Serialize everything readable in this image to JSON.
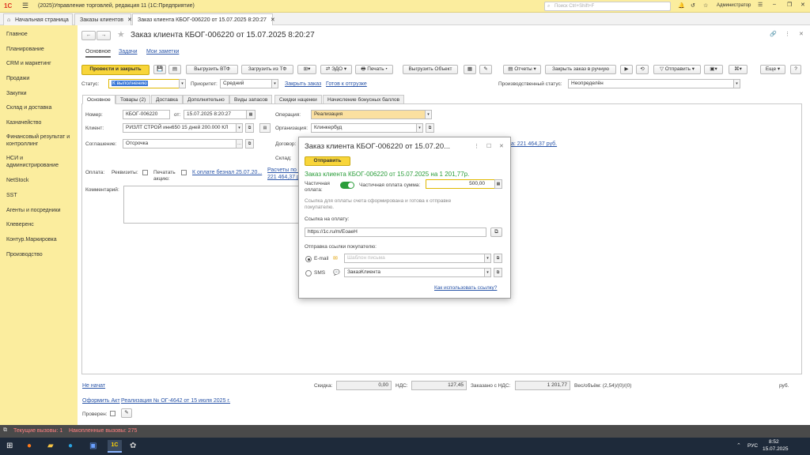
{
  "titlebar": {
    "title": "(2025)Управление торговлей, редакция 11  (1С:Предприятие)",
    "search_placeholder": "Поиск Ctrl+Shift+F",
    "user": "Администратор"
  },
  "tabs": [
    {
      "label": "Начальная страница"
    },
    {
      "label": "Заказы клиентов"
    },
    {
      "label": "Заказ клиента КБОГ-006220 от 15.07.2025 8:20:27"
    }
  ],
  "sidebar": {
    "items": [
      "Главное",
      "Планирование",
      "CRM и маркетинг",
      "Продажи",
      "Закупки",
      "Склад и доставка",
      "Казначейство",
      "Финансовый результат и контроллинг",
      "НСИ и администрирование",
      "NetStock",
      "SST",
      "Агенты и посредники",
      "Клеверенс",
      "Контур.Маркировка",
      "Производство"
    ]
  },
  "form": {
    "title": "Заказ клиента КБОГ-006220 от 15.07.2025 8:20:27",
    "subnav": [
      "Основное",
      "Задачи",
      "Мои заметки"
    ],
    "toolbar": {
      "post_close": "Провести и закрыть",
      "upload_vtf": "Выгрузить ВТФ",
      "load_tf": "Загрузить из ТФ",
      "edo": "ЭДО",
      "print": "Печать",
      "upload_obj": "Выгрузить Объект",
      "reports": "Отчеты",
      "close_manual": "Закрыть заказ в ручную",
      "send": "Отправить",
      "more": "Еще",
      "help": "?"
    },
    "status_label": "Статус:",
    "status_value": "К выполнению",
    "priority_label": "Приоритет:",
    "priority_value": "Средний",
    "close_order_link": "Закрыть заказ",
    "to_shipment_link": "Готов к отгрузке",
    "prod_status_label": "Производственный статус:",
    "prod_status_value": "Неопределён",
    "inner_tabs": [
      "Основное",
      "Товары (2)",
      "Доставка",
      "Дополнительно",
      "Виды запасов",
      "Скидки наценки",
      "Начисление бонусных баллов"
    ],
    "number_label": "Номер:",
    "number_value": "КБОГ-006220",
    "from_label": "от:",
    "date_value": "15.07.2025  8:20:27",
    "operation_label": "Операция:",
    "operation_value": "Реализация",
    "client_label": "Клиент:",
    "client_value": "РИЗЛТ СТРОЙ инн650 15 дней 200.000 КЛ",
    "org_label": "Организация:",
    "org_value": "Клинкербуд",
    "agreement_label": "Соглашение:",
    "agreement_value": "Отсрочка",
    "contract_label": "Договор:",
    "contract_link": "а: 221 464,37 руб.",
    "warehouse_label": "Склад:",
    "payment_label": "Оплата:",
    "rekvizity_label": "Реквизиты:",
    "print_promo_label": "Печатать акцию:",
    "pay_link": "К оплате безнал 25.07.20...",
    "settlements_link": "Расчеты по ...",
    "settlements_sum": "221 464,37 р...",
    "comment_label": "Комментарий:",
    "not_started_link": "Не начат",
    "discount_label": "Скидка:",
    "discount_value": "0,00",
    "vat_label": "НДС:",
    "vat_value": "127,45",
    "ordered_label": "Заказано с НДС:",
    "ordered_value": "1 201,77",
    "weight_label": "Вес/объём: (2,54)/(0)/(0)",
    "currency": "руб.",
    "act_link": "Оформить Акт",
    "realization_link": "Реализация № ОГ-4642 от 15 июля 2025 г.",
    "checked_label": "Проверен:"
  },
  "dialog": {
    "title": "Заказ клиента КБОГ-006220 от 15.07.20...",
    "send_btn": "Отправить",
    "heading": "Заказ клиента КБОГ-006220 от 15.07.2025 на 1 201,77р.",
    "partial_label": "Частичная оплата:",
    "partial_sum_label": "Частичная оплата сумма:",
    "partial_sum_value": "500,00",
    "hint": "Ссылка для оплаты счета сформирована и готова к отправке покупателю.",
    "link_label": "Ссылка на оплату:",
    "link_value": "https://1c.ru/m/EoaeH",
    "send_link_label": "Отправка ссылки покупателю:",
    "email_label": "E-mail",
    "email_placeholder": "Шаблон письма",
    "sms_label": "SMS",
    "sms_value": "ЗаказКлиента",
    "howto_link": "Как использовать ссылку?"
  },
  "statusbar": {
    "current": "Текущие вызовы: 1",
    "accum": "Накопленные вызовы: 275"
  },
  "taskbar": {
    "lang": "РУС",
    "time": "8:52",
    "date": "15.07.2025"
  },
  "colors": {
    "accent": "#f8d53a",
    "sidebar": "#fbed9e",
    "green": "#2a9d3a",
    "link": "#2a55a8"
  }
}
